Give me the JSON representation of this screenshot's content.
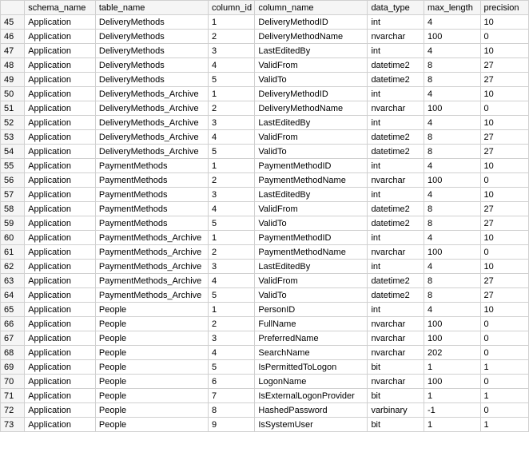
{
  "headers": {
    "rownum": "",
    "schema_name": "schema_name",
    "table_name": "table_name",
    "column_id": "column_id",
    "column_name": "column_name",
    "data_type": "data_type",
    "max_length": "max_length",
    "precision": "precision"
  },
  "rows": [
    {
      "n": "45",
      "schema": "Application",
      "table": "DeliveryMethods",
      "cid": "1",
      "col": "DeliveryMethodID",
      "dt": "int",
      "ml": "4",
      "pr": "10"
    },
    {
      "n": "46",
      "schema": "Application",
      "table": "DeliveryMethods",
      "cid": "2",
      "col": "DeliveryMethodName",
      "dt": "nvarchar",
      "ml": "100",
      "pr": "0"
    },
    {
      "n": "47",
      "schema": "Application",
      "table": "DeliveryMethods",
      "cid": "3",
      "col": "LastEditedBy",
      "dt": "int",
      "ml": "4",
      "pr": "10"
    },
    {
      "n": "48",
      "schema": "Application",
      "table": "DeliveryMethods",
      "cid": "4",
      "col": "ValidFrom",
      "dt": "datetime2",
      "ml": "8",
      "pr": "27"
    },
    {
      "n": "49",
      "schema": "Application",
      "table": "DeliveryMethods",
      "cid": "5",
      "col": "ValidTo",
      "dt": "datetime2",
      "ml": "8",
      "pr": "27"
    },
    {
      "n": "50",
      "schema": "Application",
      "table": "DeliveryMethods_Archive",
      "cid": "1",
      "col": "DeliveryMethodID",
      "dt": "int",
      "ml": "4",
      "pr": "10"
    },
    {
      "n": "51",
      "schema": "Application",
      "table": "DeliveryMethods_Archive",
      "cid": "2",
      "col": "DeliveryMethodName",
      "dt": "nvarchar",
      "ml": "100",
      "pr": "0"
    },
    {
      "n": "52",
      "schema": "Application",
      "table": "DeliveryMethods_Archive",
      "cid": "3",
      "col": "LastEditedBy",
      "dt": "int",
      "ml": "4",
      "pr": "10"
    },
    {
      "n": "53",
      "schema": "Application",
      "table": "DeliveryMethods_Archive",
      "cid": "4",
      "col": "ValidFrom",
      "dt": "datetime2",
      "ml": "8",
      "pr": "27"
    },
    {
      "n": "54",
      "schema": "Application",
      "table": "DeliveryMethods_Archive",
      "cid": "5",
      "col": "ValidTo",
      "dt": "datetime2",
      "ml": "8",
      "pr": "27"
    },
    {
      "n": "55",
      "schema": "Application",
      "table": "PaymentMethods",
      "cid": "1",
      "col": "PaymentMethodID",
      "dt": "int",
      "ml": "4",
      "pr": "10"
    },
    {
      "n": "56",
      "schema": "Application",
      "table": "PaymentMethods",
      "cid": "2",
      "col": "PaymentMethodName",
      "dt": "nvarchar",
      "ml": "100",
      "pr": "0"
    },
    {
      "n": "57",
      "schema": "Application",
      "table": "PaymentMethods",
      "cid": "3",
      "col": "LastEditedBy",
      "dt": "int",
      "ml": "4",
      "pr": "10"
    },
    {
      "n": "58",
      "schema": "Application",
      "table": "PaymentMethods",
      "cid": "4",
      "col": "ValidFrom",
      "dt": "datetime2",
      "ml": "8",
      "pr": "27"
    },
    {
      "n": "59",
      "schema": "Application",
      "table": "PaymentMethods",
      "cid": "5",
      "col": "ValidTo",
      "dt": "datetime2",
      "ml": "8",
      "pr": "27"
    },
    {
      "n": "60",
      "schema": "Application",
      "table": "PaymentMethods_Archive",
      "cid": "1",
      "col": "PaymentMethodID",
      "dt": "int",
      "ml": "4",
      "pr": "10"
    },
    {
      "n": "61",
      "schema": "Application",
      "table": "PaymentMethods_Archive",
      "cid": "2",
      "col": "PaymentMethodName",
      "dt": "nvarchar",
      "ml": "100",
      "pr": "0"
    },
    {
      "n": "62",
      "schema": "Application",
      "table": "PaymentMethods_Archive",
      "cid": "3",
      "col": "LastEditedBy",
      "dt": "int",
      "ml": "4",
      "pr": "10"
    },
    {
      "n": "63",
      "schema": "Application",
      "table": "PaymentMethods_Archive",
      "cid": "4",
      "col": "ValidFrom",
      "dt": "datetime2",
      "ml": "8",
      "pr": "27"
    },
    {
      "n": "64",
      "schema": "Application",
      "table": "PaymentMethods_Archive",
      "cid": "5",
      "col": "ValidTo",
      "dt": "datetime2",
      "ml": "8",
      "pr": "27"
    },
    {
      "n": "65",
      "schema": "Application",
      "table": "People",
      "cid": "1",
      "col": "PersonID",
      "dt": "int",
      "ml": "4",
      "pr": "10"
    },
    {
      "n": "66",
      "schema": "Application",
      "table": "People",
      "cid": "2",
      "col": "FullName",
      "dt": "nvarchar",
      "ml": "100",
      "pr": "0"
    },
    {
      "n": "67",
      "schema": "Application",
      "table": "People",
      "cid": "3",
      "col": "PreferredName",
      "dt": "nvarchar",
      "ml": "100",
      "pr": "0"
    },
    {
      "n": "68",
      "schema": "Application",
      "table": "People",
      "cid": "4",
      "col": "SearchName",
      "dt": "nvarchar",
      "ml": "202",
      "pr": "0"
    },
    {
      "n": "69",
      "schema": "Application",
      "table": "People",
      "cid": "5",
      "col": "IsPermittedToLogon",
      "dt": "bit",
      "ml": "1",
      "pr": "1"
    },
    {
      "n": "70",
      "schema": "Application",
      "table": "People",
      "cid": "6",
      "col": "LogonName",
      "dt": "nvarchar",
      "ml": "100",
      "pr": "0"
    },
    {
      "n": "71",
      "schema": "Application",
      "table": "People",
      "cid": "7",
      "col": "IsExternalLogonProvider",
      "dt": "bit",
      "ml": "1",
      "pr": "1"
    },
    {
      "n": "72",
      "schema": "Application",
      "table": "People",
      "cid": "8",
      "col": "HashedPassword",
      "dt": "varbinary",
      "ml": "-1",
      "pr": "0"
    },
    {
      "n": "73",
      "schema": "Application",
      "table": "People",
      "cid": "9",
      "col": "IsSystemUser",
      "dt": "bit",
      "ml": "1",
      "pr": "1"
    }
  ]
}
